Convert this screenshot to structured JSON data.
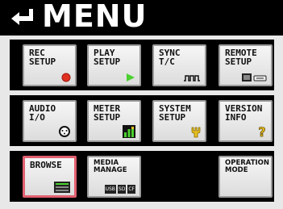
{
  "header": {
    "title": "MENU"
  },
  "buttons": {
    "rec_setup": {
      "line1": "REC",
      "line2": "SETUP"
    },
    "play_setup": {
      "line1": "PLAY",
      "line2": "SETUP"
    },
    "sync_tc": {
      "line1": "SYNC",
      "line2": "T/C"
    },
    "remote_setup": {
      "line1": "REMOTE",
      "line2": "SETUP"
    },
    "audio_io": {
      "line1": "AUDIO",
      "line2": "I/O"
    },
    "meter_setup": {
      "line1": "METER",
      "line2": "SETUP"
    },
    "system_setup": {
      "line1": "SYSTEM",
      "line2": "SETUP"
    },
    "version_info": {
      "line1": "VERSION",
      "line2": "INFO"
    },
    "browse": {
      "line1": "BROWSE"
    },
    "media_manage": {
      "line1": "MEDIA",
      "line2": "MANAGE"
    },
    "operation_mode": {
      "line1": "OPERATION",
      "line2": "MODE"
    }
  },
  "media_badges": [
    "USB",
    "SD",
    "CF"
  ],
  "colors": {
    "selected_border": "#e06070",
    "rec_dot": "#e03020",
    "play_triangle": "#4ad030"
  },
  "icons": [
    "back-arrow-icon",
    "record-dot-icon",
    "play-triangle-icon",
    "timecode-wave-icon",
    "remote-keyboard-icon",
    "xlr-connector-icon",
    "level-meter-icon",
    "wrench-icon",
    "question-icon",
    "file-list-icon"
  ]
}
